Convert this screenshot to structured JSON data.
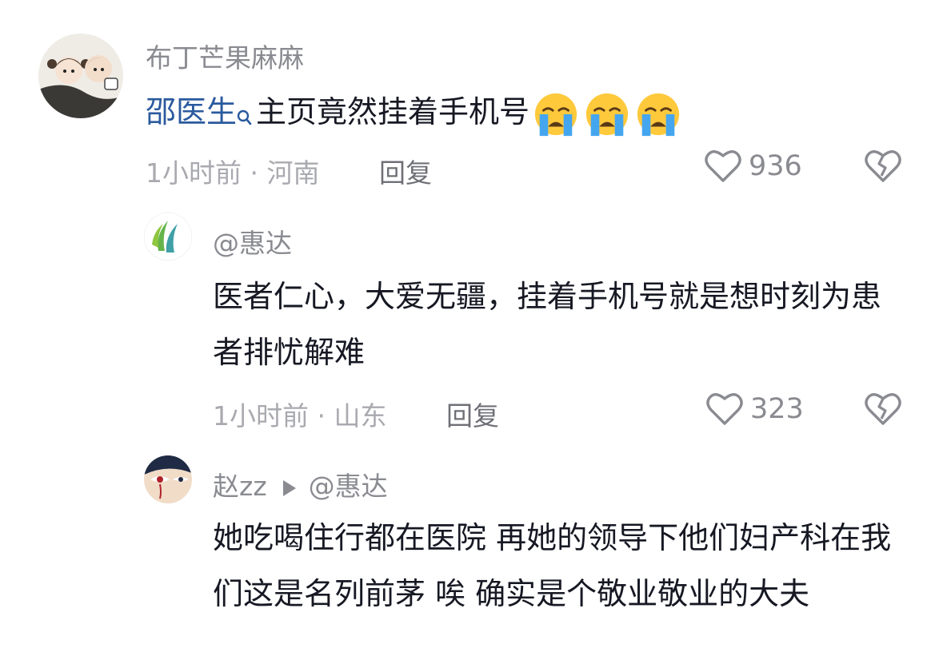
{
  "comment1": {
    "username": "布丁芒果麻麻",
    "mention": "邵医生",
    "text": "主页竟然挂着手机号",
    "emojis": [
      "crying-face",
      "crying-face",
      "crying-face"
    ],
    "time_location": "1小时前 · 河南",
    "reply_label": "回复",
    "like_count": "936"
  },
  "comment2": {
    "username": "@惠达",
    "text": "医者仁心，大爱无疆，挂着手机号就是想时刻为患者排忧解难",
    "time_location": "1小时前 · 山东",
    "reply_label": "回复",
    "like_count": "323"
  },
  "comment3": {
    "username": "赵zz",
    "reply_to": "@惠达",
    "text": "她吃喝住行都在医院 再她的领导下他们妇产科在我们这是名列前茅 唉 确实是个敬业敬业的大夫"
  },
  "colors": {
    "mention": "#2b5a9e",
    "username": "#8a8b91",
    "meta": "#a9aab0",
    "text": "#161823"
  }
}
